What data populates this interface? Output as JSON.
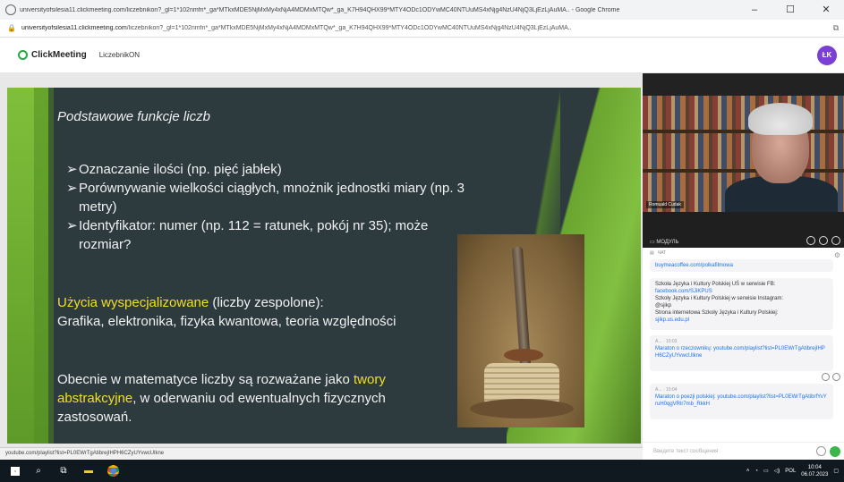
{
  "browser": {
    "title": "universityofsilesia11.clickmeeting.com/liczebnikon?_gl=1*102nmfn*_ga*MTkxMDE5NjMxMy4xNjA4MDMxMTQw*_ga_K7H94QHX99*MTY4ODc1ODYwMC40NTUuMS4xNjg4NzU4NjQ3LjEzLjAuMA.. - Google Chrome",
    "url_host": "universityofsilesia11.clickmeeting.com",
    "url_rest": "/liczebnikon?_gl=1*102nmfn*_ga*MTkxMDE5NjMxMy4xNjA4MDMxMTQw*_ga_K7H94QHX99*MTY4ODc1ODYwMC40NTUuMS4xNjg4NzU4NjQ3LjEzLjAuMA..",
    "minimize": "–",
    "maximize": "☐",
    "close": "✕"
  },
  "header": {
    "logo": "ClickMeeting",
    "room": "LiczebnikON",
    "avatar_initials": "ŁK"
  },
  "slide": {
    "title": "Podstawowe funkcje liczb",
    "bullet_marker": "➢",
    "bullets": [
      "Oznaczanie ilości (np. pięć jabłek)",
      "Porównywanie wielkości ciągłych, mnożnik jednostki miary (np. 3 metry)",
      "Identyfikator: numer (np. 112 = ratunek, pokój nr 35); może rozmiar?"
    ],
    "special_highlight": "Użycia wyspecjalizowane",
    "special_rest": " (liczby zespolone):",
    "special_line2": "Grafika, elektronika, fizyka kwantowa, teoria względności",
    "modern_pre": "Obecnie w matematyce liczby są rozważane jako ",
    "modern_highlight": "twory abstrakcyjne",
    "modern_post": ", w oderwaniu od ewentualnych fizycznych zastosowań."
  },
  "status_url": "youtube.com/playlist?list=PL0EWrTgAtibrejIHPH6CZyUYvwcUlkne",
  "video": {
    "presenter_name": "Romuald Cudak",
    "module_label": "МОДУЛЬ"
  },
  "chat": {
    "header": "ЧАТ",
    "messages": [
      {
        "lines": [
          "buymeacoffee.com/polkafilmowa"
        ],
        "links": [
          true
        ]
      },
      {
        "lines": [
          "Szkoła Języka i Kultury Polskiej UŚ w serwisie FB:",
          "facebook.com/SJiKPUS",
          "Szkoły Języka i Kultury Polskiej w serwisie Instagram:",
          "@sjikp",
          "Strona internetowa Szkoły Języka i Kultury Polskiej:",
          "sjikp.us.edu.pl"
        ],
        "links": [
          false,
          true,
          false,
          false,
          false,
          true
        ]
      },
      {
        "meta": "A... · 10:03",
        "lines": [
          "Maraton o rzeczownikų: youtube.com/playlist?list=PL0EWrTgAtibrejIHPH6CZyUYvwcUlkne"
        ],
        "links": [
          true
        ]
      },
      {
        "meta": "A... · 10:04",
        "lines": [
          "Maraton o poezji polskiej: youtube.com/playlist?list=PL0EWrTgAtibrfYvYruH0qgVRlr7mb_RkkH"
        ],
        "links": [
          true
        ]
      }
    ],
    "input_placeholder": "Введите текст сообщения"
  },
  "taskbar": {
    "time": "10:04",
    "date": "06.07.2023",
    "lang": "POL"
  }
}
